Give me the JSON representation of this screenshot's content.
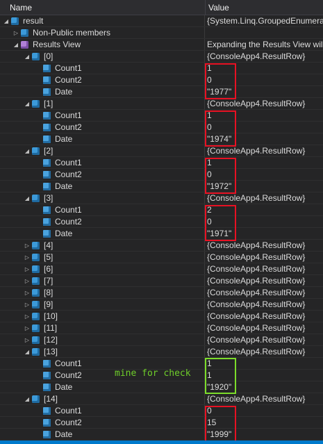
{
  "header": {
    "name": "Name",
    "value": "Value"
  },
  "annotation": "mine for check",
  "colors": {
    "red_box": "#e81123",
    "green_box": "#7cdd2a",
    "note": "#6fcf2a"
  },
  "rows": [
    {
      "level": 0,
      "expanded": true,
      "icon": "object-icon",
      "name": "result",
      "value": "{System.Linq.GroupedEnumera"
    },
    {
      "level": 1,
      "expanded": false,
      "icon": "object-icon",
      "name": "Non-Public members",
      "value": ""
    },
    {
      "level": 1,
      "expanded": true,
      "icon": "method-icon",
      "name": "Results View",
      "value": "Expanding the Results View will"
    },
    {
      "level": 2,
      "expanded": true,
      "icon": "object-icon",
      "name": "[0]",
      "value": "{ConsoleApp4.ResultRow}"
    },
    {
      "level": 3,
      "icon": "field-icon",
      "name": "Count1",
      "value": "1"
    },
    {
      "level": 3,
      "icon": "field-icon",
      "name": "Count2",
      "value": "0"
    },
    {
      "level": 3,
      "icon": "field-icon",
      "name": "Date",
      "value": "\"1977\""
    },
    {
      "level": 2,
      "expanded": true,
      "icon": "object-icon",
      "name": "[1]",
      "value": "{ConsoleApp4.ResultRow}"
    },
    {
      "level": 3,
      "icon": "field-icon",
      "name": "Count1",
      "value": "1"
    },
    {
      "level": 3,
      "icon": "field-icon",
      "name": "Count2",
      "value": "0"
    },
    {
      "level": 3,
      "icon": "field-icon",
      "name": "Date",
      "value": "\"1974\""
    },
    {
      "level": 2,
      "expanded": true,
      "icon": "object-icon",
      "name": "[2]",
      "value": "{ConsoleApp4.ResultRow}"
    },
    {
      "level": 3,
      "icon": "field-icon",
      "name": "Count1",
      "value": "1"
    },
    {
      "level": 3,
      "icon": "field-icon",
      "name": "Count2",
      "value": "0"
    },
    {
      "level": 3,
      "icon": "field-icon",
      "name": "Date",
      "value": "\"1972\""
    },
    {
      "level": 2,
      "expanded": true,
      "icon": "object-icon",
      "name": "[3]",
      "value": "{ConsoleApp4.ResultRow}"
    },
    {
      "level": 3,
      "icon": "field-icon",
      "name": "Count1",
      "value": "2"
    },
    {
      "level": 3,
      "icon": "field-icon",
      "name": "Count2",
      "value": "0"
    },
    {
      "level": 3,
      "icon": "field-icon",
      "name": "Date",
      "value": "\"1971\""
    },
    {
      "level": 2,
      "expanded": false,
      "icon": "object-icon",
      "name": "[4]",
      "value": "{ConsoleApp4.ResultRow}"
    },
    {
      "level": 2,
      "expanded": false,
      "icon": "object-icon",
      "name": "[5]",
      "value": "{ConsoleApp4.ResultRow}"
    },
    {
      "level": 2,
      "expanded": false,
      "icon": "object-icon",
      "name": "[6]",
      "value": "{ConsoleApp4.ResultRow}"
    },
    {
      "level": 2,
      "expanded": false,
      "icon": "object-icon",
      "name": "[7]",
      "value": "{ConsoleApp4.ResultRow}"
    },
    {
      "level": 2,
      "expanded": false,
      "icon": "object-icon",
      "name": "[8]",
      "value": "{ConsoleApp4.ResultRow}"
    },
    {
      "level": 2,
      "expanded": false,
      "icon": "object-icon",
      "name": "[9]",
      "value": "{ConsoleApp4.ResultRow}"
    },
    {
      "level": 2,
      "expanded": false,
      "icon": "object-icon",
      "name": "[10]",
      "value": "{ConsoleApp4.ResultRow}"
    },
    {
      "level": 2,
      "expanded": false,
      "icon": "object-icon",
      "name": "[11]",
      "value": "{ConsoleApp4.ResultRow}"
    },
    {
      "level": 2,
      "expanded": false,
      "icon": "object-icon",
      "name": "[12]",
      "value": "{ConsoleApp4.ResultRow}"
    },
    {
      "level": 2,
      "expanded": true,
      "icon": "object-icon",
      "name": "[13]",
      "value": "{ConsoleApp4.ResultRow}"
    },
    {
      "level": 3,
      "icon": "field-icon",
      "name": "Count1",
      "value": "1"
    },
    {
      "level": 3,
      "icon": "field-icon",
      "name": "Count2",
      "value": "1"
    },
    {
      "level": 3,
      "icon": "field-icon",
      "name": "Date",
      "value": "\"1920\""
    },
    {
      "level": 2,
      "expanded": true,
      "icon": "object-icon",
      "name": "[14]",
      "value": "{ConsoleApp4.ResultRow}"
    },
    {
      "level": 3,
      "icon": "field-icon",
      "name": "Count1",
      "value": "0"
    },
    {
      "level": 3,
      "icon": "field-icon",
      "name": "Count2",
      "value": "15"
    },
    {
      "level": 3,
      "icon": "field-icon",
      "name": "Date",
      "value": "\"1999\""
    }
  ]
}
